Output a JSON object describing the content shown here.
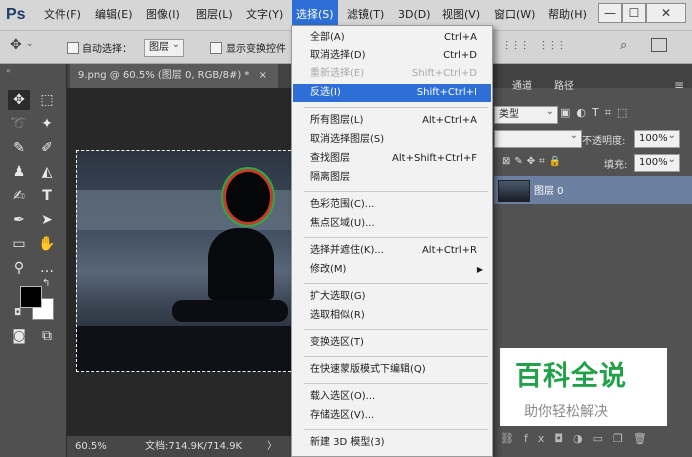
{
  "app": {
    "logo": "Ps"
  },
  "menubar": {
    "items": [
      "文件(F)",
      "编辑(E)",
      "图像(I)",
      "图层(L)",
      "文字(Y)",
      "选择(S)",
      "滤镜(T)",
      "3D(D)",
      "视图(V)",
      "窗口(W)",
      "帮助(H)"
    ],
    "active_index": 5,
    "win_controls": [
      "—",
      "☐",
      "✕"
    ]
  },
  "options": {
    "auto_select_label": "自动选择：",
    "auto_select_target": "图层",
    "show_transform_label": "显示变换控件"
  },
  "document": {
    "tab_title": "9.png @ 60.5% (图层 0, RGB/8#) *",
    "tab_close": "×",
    "zoom": "60.5%",
    "doc_info": "文档:714.9K/714.9K",
    "status_arrow": "〉"
  },
  "panels": {
    "tabs": [
      "通道",
      "路径"
    ],
    "kind_label": "类型",
    "opacity_label": "不透明度:",
    "opacity_value": "100%",
    "fill_label": "填充:",
    "fill_value": "100%",
    "lock_label": "锁定:",
    "layer_name": "图层 0"
  },
  "select_menu": {
    "items": [
      {
        "label": "全部(A)",
        "shortcut": "Ctrl+A"
      },
      {
        "label": "取消选择(D)",
        "shortcut": "Ctrl+D"
      },
      {
        "label": "重新选择(E)",
        "shortcut": "Shift+Ctrl+D",
        "disabled": true
      },
      {
        "label": "反选(I)",
        "shortcut": "Shift+Ctrl+I",
        "highlighted": true
      },
      {
        "label": "所有图层(L)",
        "shortcut": "Alt+Ctrl+A"
      },
      {
        "label": "取消选择图层(S)",
        "shortcut": ""
      },
      {
        "label": "查找图层",
        "shortcut": "Alt+Shift+Ctrl+F"
      },
      {
        "label": "隔离图层",
        "shortcut": ""
      },
      {
        "label": "色彩范围(C)...",
        "shortcut": ""
      },
      {
        "label": "焦点区域(U)...",
        "shortcut": ""
      },
      {
        "label": "选择并遮住(K)...",
        "shortcut": "Alt+Ctrl+R"
      },
      {
        "label": "修改(M)",
        "shortcut": "",
        "submenu": true
      },
      {
        "label": "扩大选取(G)",
        "shortcut": ""
      },
      {
        "label": "选取相似(R)",
        "shortcut": ""
      },
      {
        "label": "变换选区(T)",
        "shortcut": ""
      },
      {
        "label": "在快速蒙版模式下编辑(Q)",
        "shortcut": ""
      },
      {
        "label": "载入选区(O)...",
        "shortcut": ""
      },
      {
        "label": "存储选区(V)...",
        "shortcut": ""
      },
      {
        "label": "新建 3D 模型(3)",
        "shortcut": ""
      }
    ]
  },
  "watermark": {
    "title": "百科全说",
    "subtitle": "助你轻松解决",
    "color": "#23a14a"
  }
}
